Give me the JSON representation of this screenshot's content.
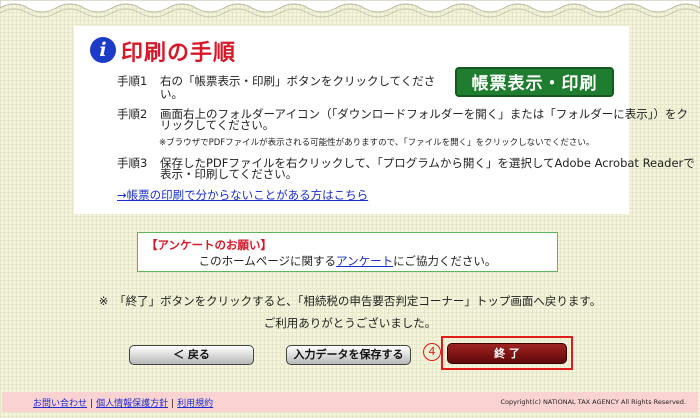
{
  "guide": {
    "title": "印刷の手順",
    "icon": "info-icon",
    "print_button_label": "帳票表示・印刷",
    "steps": [
      {
        "num": "手順1",
        "text": "右の「帳票表示・印刷」ボタンをクリックしてください。"
      },
      {
        "num": "手順2",
        "line1": "画面右上のフォルダーアイコン（「ダウンロードフォルダーを開く」または「フォルダーに表示」）をク",
        "line2": "リックしてください。"
      },
      {
        "num": "手順3",
        "line1": "保存したPDFファイルを右クリックして、「プログラムから開く」を選択してAdobe Acrobat Readerで",
        "line2": "表示・印刷してください。"
      }
    ],
    "note": "※ブラウザでPDFファイルが表示される可能性がありますので、「ファイルを開く」をクリックしないでください。",
    "help_link": "→帳票の印刷で分からないことがある方はこちら"
  },
  "survey": {
    "title": "【アンケートのお願い】",
    "text_before": "このホームページに関する",
    "link": "アンケート",
    "text_after": "にご協力ください。"
  },
  "end_note": {
    "line1": "※　「終了」ボタンをクリックすると、「相続税の申告要否判定コーナー」トップ画面へ戻ります。",
    "line2": "ご利用ありがとうございました。"
  },
  "buttons": {
    "back": "＜ 戻る",
    "save": "入力データを保存する",
    "step_marker": "④",
    "end": "終 了"
  },
  "footer": {
    "links": [
      "お問い合わせ",
      "個人情報保護方針",
      "利用規約"
    ],
    "separator": "|",
    "copyright": "Copyright(c) NATIONAL TAX AGENCY All Rights Reserved."
  },
  "colors": {
    "accent_red": "#d41a2a",
    "print_button_green": "#1e7d2e",
    "end_button": "#7a1212",
    "footer_bg": "#fbd2d2"
  }
}
